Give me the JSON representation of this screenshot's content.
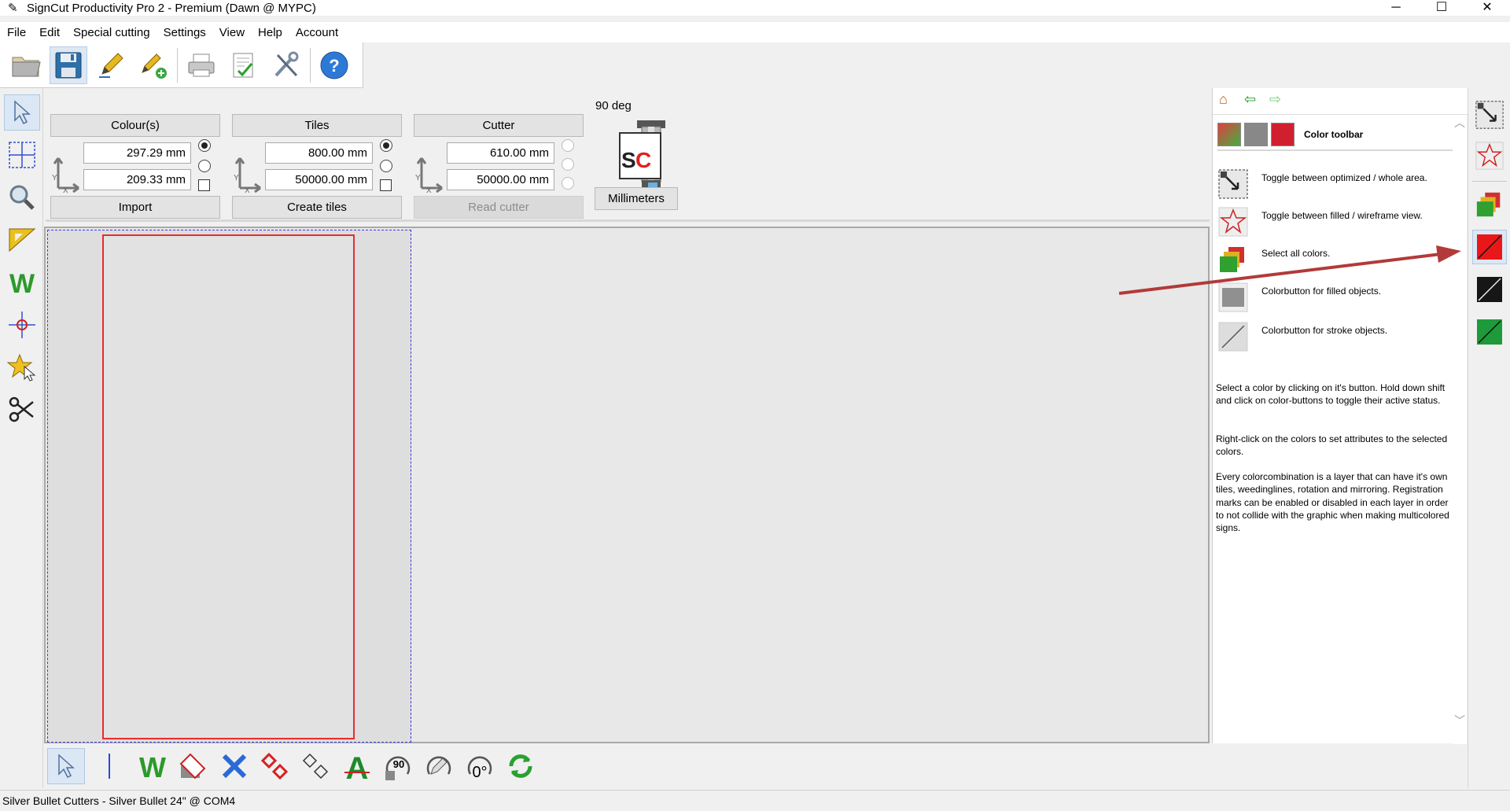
{
  "window": {
    "title": "SignCut Productivity Pro 2 - Premium (Dawn @ MYPC)",
    "minimize": "─",
    "maximize": "☐",
    "close": "✕"
  },
  "menu": [
    "File",
    "Edit",
    "Special cutting",
    "Settings",
    "View",
    "Help",
    "Account"
  ],
  "colours_group": {
    "header": "Colour(s)",
    "value1": "297.29 mm",
    "value2": "209.33 mm",
    "button": "Import"
  },
  "tiles_group": {
    "header": "Tiles",
    "value1": "800.00 mm",
    "value2": "50000.00 mm",
    "button": "Create tiles"
  },
  "cutter_group": {
    "header": "Cutter",
    "value1": "610.00 mm",
    "value2": "50000.00 mm",
    "button": "Read cutter"
  },
  "rotation": {
    "label": "90 deg",
    "units_button": "Millimeters"
  },
  "help": {
    "title": "Color toolbar",
    "items": [
      "Toggle between optimized / whole area.",
      "Toggle between filled / wireframe view.",
      "Select all colors.",
      "Colorbutton for filled objects.",
      "Colorbutton for stroke objects."
    ],
    "paragraphs": [
      "Select a color by clicking on it's button. Hold down shift and click on color-buttons to toggle their active status.",
      "Right-click on the colors to set attributes to the selected colors.",
      "Every colorcombination is a layer that can have it's own tiles, weedinglines, rotation and mirroring. Registration marks can be enabled or disabled in each layer in order to not collide with the graphic when making multicolored signs."
    ]
  },
  "bottom": {
    "rotate_90_label": "90",
    "rotate_0_label": "0°"
  },
  "status": "Silver Bullet Cutters - Silver Bullet 24\" @ COM4",
  "colors": {
    "accent": "#e82c2c",
    "selection": "#3b3bd8",
    "arrow": "#b23a3a"
  }
}
